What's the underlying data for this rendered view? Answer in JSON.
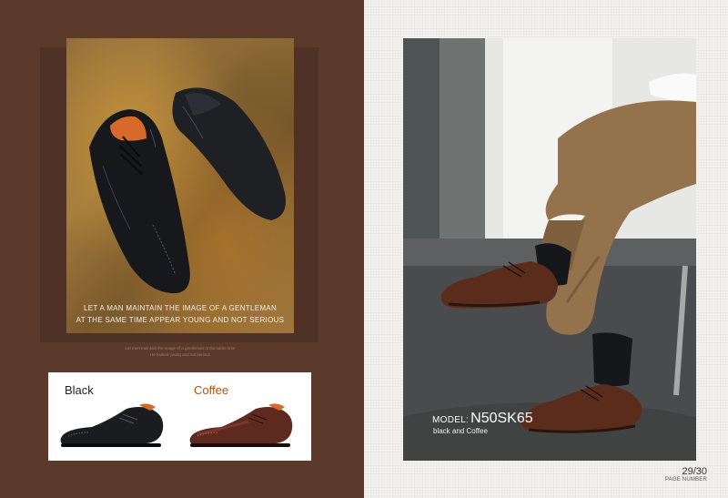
{
  "left_photo": {
    "tagline_line1": "LET A MAN MAINTAIN THE IMAGE OF A GENTLEMAN",
    "tagline_line2": "AT THE SAME TIME APPEAR YOUNG AND NOT SERIOUS",
    "caption_line1": "Let men maintain the image of a gentleman at the same time",
    "caption_line2": "He looked young and not serious"
  },
  "color_options": [
    {
      "label": "Black"
    },
    {
      "label": "Coffee"
    }
  ],
  "model": {
    "prefix": "MODEL:",
    "code": "N50SK65",
    "colors": "black and Coffee"
  },
  "page": {
    "number": "29/30",
    "label": "PAGE NUMBER"
  }
}
